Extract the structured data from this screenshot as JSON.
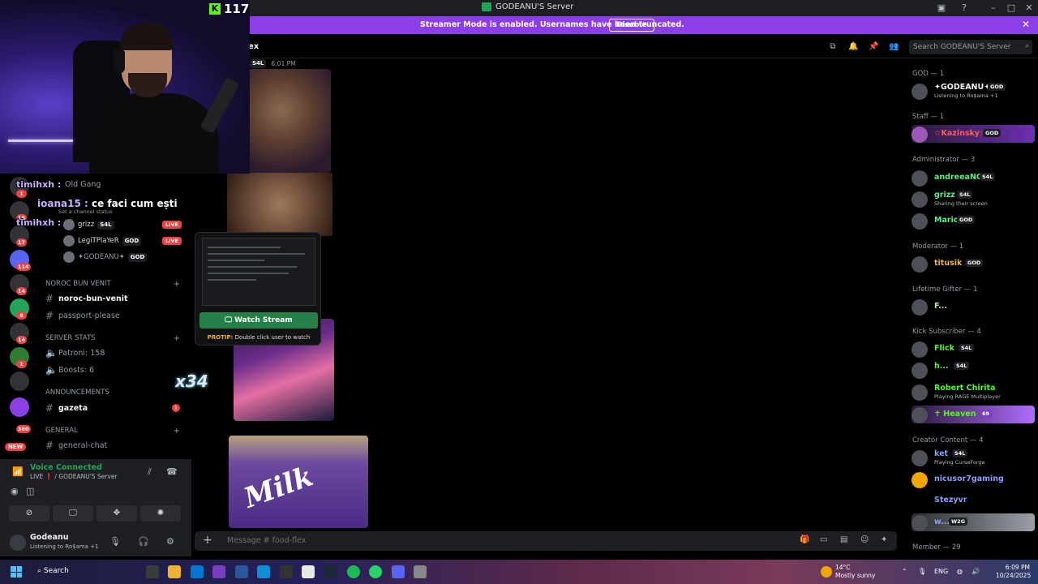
{
  "titlebar": {
    "title": "GODEANU'S Server"
  },
  "streamer_bar": {
    "message": "Streamer Mode is enabled. Usernames have been truncated.",
    "disable_label": "Disable"
  },
  "channel_header": {
    "name": "ex",
    "search_placeholder": "Search GODEANU'S Server"
  },
  "webcam": {
    "kick_count": "117"
  },
  "stream_chat": [
    {
      "user": "timihxh :",
      "text": ""
    },
    {
      "user": "ioana15 :",
      "text": "ce faci cum ești"
    },
    {
      "user": "timihxh :",
      "text": ""
    }
  ],
  "emote_text": "x34",
  "sidebar": {
    "top_channel": "Old Gang",
    "status_hint": "Set a channel status",
    "voice_users": [
      {
        "name": "grizz",
        "tag": "S4L",
        "live": "LIVE"
      },
      {
        "name": "LegiTPlaYeR",
        "tag": "GOD",
        "live": "LIVE"
      },
      {
        "name": "✦GODEANU✦",
        "tag": "GOD",
        "live": ""
      }
    ],
    "categories": {
      "noroc": "NOROC BUN VENIT",
      "stats": "SERVER STATS",
      "announcements": "ANNOUNCEMENTS",
      "general": "GENERAL"
    },
    "channels": {
      "noroc_bun_venit": "noroc-bun-venit",
      "passport": "passport-please",
      "patroni": "Patroni: 158",
      "boosts": "Boosts: 6",
      "gazeta": "gazeta",
      "general_chat": "general-chat"
    },
    "gazeta_badge": "1"
  },
  "rail": {
    "badges": [
      "1",
      "15",
      "17",
      "114",
      "14",
      "8",
      "14",
      "1",
      "360"
    ],
    "new_label": "NEW"
  },
  "voice": {
    "title": "Voice Connected",
    "subtitle": "LIVE ❗ / GODEANU'S Server"
  },
  "user_panel": {
    "name": "Godeanu",
    "status": "Listening to Ro$ama",
    "extra": "+1"
  },
  "chat": {
    "msg_tag": "S4L",
    "msg_time": "6:01 PM",
    "watch_label": "Watch Stream",
    "protip_label": "PROTIP:",
    "protip_text": "Double click user to watch",
    "milka_text": "Milk",
    "composer_placeholder": "Message # food-flex"
  },
  "members": {
    "categories": {
      "god": "GOD — 1",
      "staff": "Staff — 1",
      "admin": "Administrator — 3",
      "mod": "Moderator — 1",
      "gifter": "Lifetime Gifter — 1",
      "kick": "Kick Subscriber — 4",
      "creator": "Creator Content — 4",
      "member": "Member — 29"
    },
    "rows": {
      "godeanu": {
        "name": "✦GODEANU✦",
        "tag": "GOD",
        "status": "Listening to Ro$ama +1"
      },
      "kazinsky": {
        "name": "☆Kazinsky☆",
        "tag": "GOD"
      },
      "andreea": {
        "name": "andreeaNGU",
        "tag": "S4L"
      },
      "grizz": {
        "name": "grizz",
        "tag": "S4L",
        "status": "Sharing their screen"
      },
      "mario": {
        "name": "Mario",
        "tag": "GOD"
      },
      "titusik": {
        "name": "titusik",
        "tag": "GOD"
      },
      "f": {
        "name": "F..."
      },
      "flick": {
        "name": "Flick",
        "tag": "S4L"
      },
      "h": {
        "name": "h...",
        "tag": "S4L"
      },
      "robert": {
        "name": "Robert Chirita",
        "status": "Playing RAGE Multiplayer"
      },
      "heaven": {
        "name": "✝ Heaven ✝",
        "tag": "69"
      },
      "ket": {
        "name": "ket",
        "tag": "S4L",
        "status": "Playing CurseForge"
      },
      "nicusor": {
        "name": "nicusor7gaming"
      },
      "stezyvr": {
        "name": "Stezyvr"
      },
      "w": {
        "name": "w...",
        "tag": "W2G"
      }
    }
  },
  "taskbar": {
    "search": "Search",
    "temp": "14°C",
    "weather": "Mostly sunny",
    "lang": "ENG",
    "time": "6:09 PM",
    "date": "10/24/2025"
  }
}
